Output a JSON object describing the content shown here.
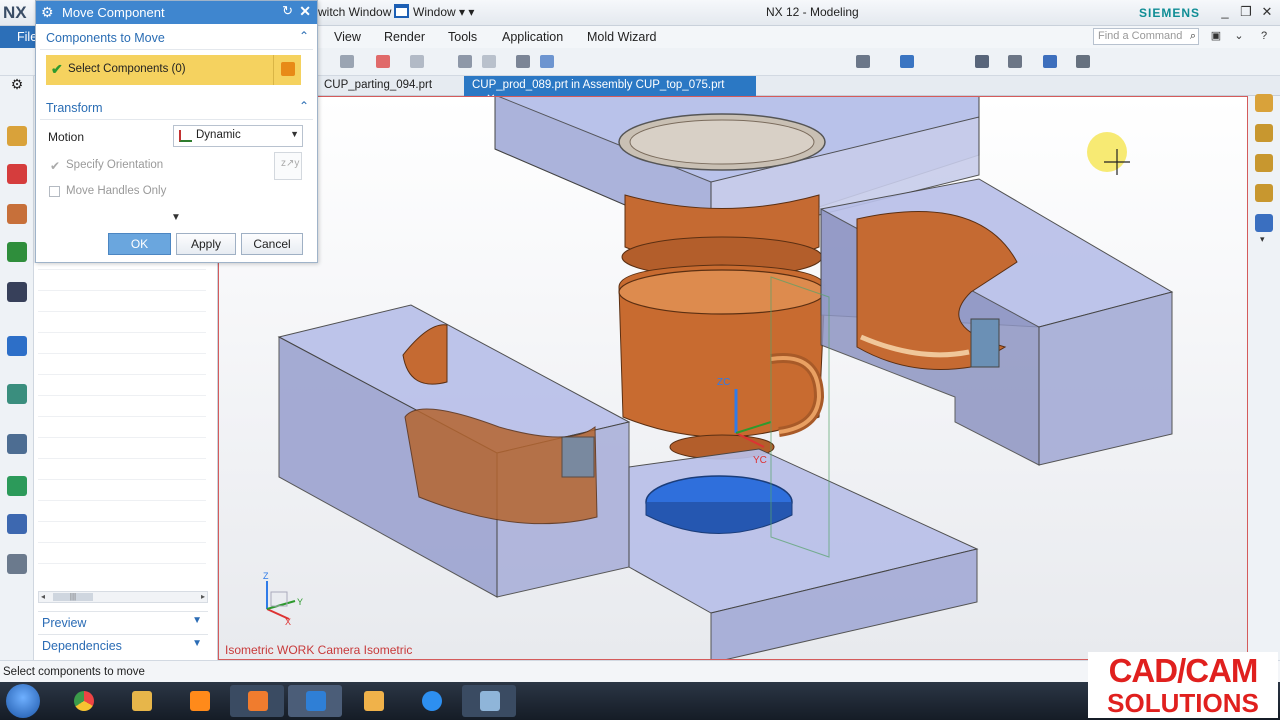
{
  "titlebar": {
    "logo": "NX",
    "switch_window": "witch Window",
    "window_menu": "Window ▾ ▾",
    "app_title": "NX 12 - Modeling",
    "brand": "SIEMENS",
    "minimize": "_",
    "restore": "❐",
    "close": "✕"
  },
  "menubar": {
    "file": "File",
    "items": [
      "View",
      "Render",
      "Tools",
      "Application",
      "Mold Wizard"
    ],
    "find_placeholder": "Find a Command"
  },
  "doc_tabs": [
    {
      "label": "CUP_parting_094.prt",
      "active": false
    },
    {
      "label": "CUP_prod_089.prt in Assembly CUP_top_075.prt",
      "active": true
    }
  ],
  "dialog": {
    "title": "Move Component",
    "components_group": "Components to Move",
    "select_label": "Select Components (0)",
    "transform_group": "Transform",
    "motion_label": "Motion",
    "motion_value": "Dynamic",
    "specify_orientation": "Specify Orientation",
    "move_handles_only": "Move Handles Only",
    "ok": "OK",
    "apply": "Apply",
    "cancel": "Cancel"
  },
  "navigator": {
    "preview": "Preview",
    "dependencies": "Dependencies"
  },
  "graphics": {
    "view_label": "Isometric WORK Camera Isometric",
    "triad_labels": {
      "z": "Z",
      "y": "Y",
      "x": "X"
    },
    "csys_labels": {
      "zc": "ZC",
      "yc": "YC"
    }
  },
  "status": {
    "text": "Select components to move"
  },
  "watermark": {
    "top": "CAD/CAM",
    "bottom": "SOLUTIONS"
  },
  "colors": {
    "accent": "#3f86cf",
    "select_highlight": "#f5d25f",
    "part_copper": "#c56a32",
    "mold_plate": "#b7bfe6",
    "core_insert": "#2f6fdc",
    "brand": "#0f8d95",
    "watermark": "#e0201e"
  },
  "icons": [
    "gear-icon",
    "reset-icon",
    "close-icon",
    "select-object-icon",
    "dynamic-csys-icon",
    "orientation-icon",
    "chevron-down-icon",
    "chevron-up-icon",
    "search-icon"
  ]
}
